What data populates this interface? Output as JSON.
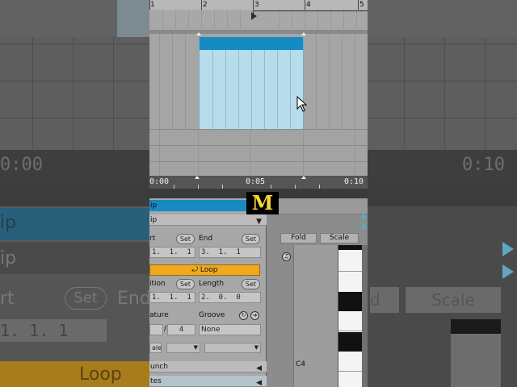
{
  "ruler": {
    "bars": [
      "1",
      "2",
      "3",
      "4",
      "5"
    ]
  },
  "timeline": {
    "left_time": "0:00",
    "mid_time": "0:05",
    "right_time": "0:10"
  },
  "clip_view": {
    "title": "ip",
    "section_clip": "ip",
    "start_label": "rt",
    "start_set": "Set",
    "start_value": "1.  1.  1",
    "end_label": "End",
    "end_set": "Set",
    "end_value": "3.  1.  1",
    "loop_label": "Loop",
    "position_label": "ition",
    "position_set": "Set",
    "position_value": "1.  1.  1",
    "length_label": "Length",
    "length_set": "Set",
    "length_value": "2.  0.  0",
    "signature_label": "ature",
    "signature_num": "",
    "signature_den": "4",
    "groove_label": "Groove",
    "groove_value": "None",
    "scale_label": "ale",
    "launch_label": "unch",
    "notes_label": "tes"
  },
  "midi_view": {
    "fold_label": "Fold",
    "scale_label": "Scale",
    "note_label": "C4"
  },
  "background": {
    "time_left": "0:00",
    "time_right": "0:10",
    "set_label": "Set",
    "end_label": "End",
    "value": "1.  1.  1",
    "loop_label": "Loop",
    "rbtn1": "d",
    "rbtn2": "Scale"
  },
  "logo": {
    "letter": "M"
  },
  "colors": {
    "clip_blue": "#168ac2",
    "clip_body": "#b7dcec",
    "loop_orange": "#f0a81f",
    "logo_yellow": "#f6d633"
  }
}
